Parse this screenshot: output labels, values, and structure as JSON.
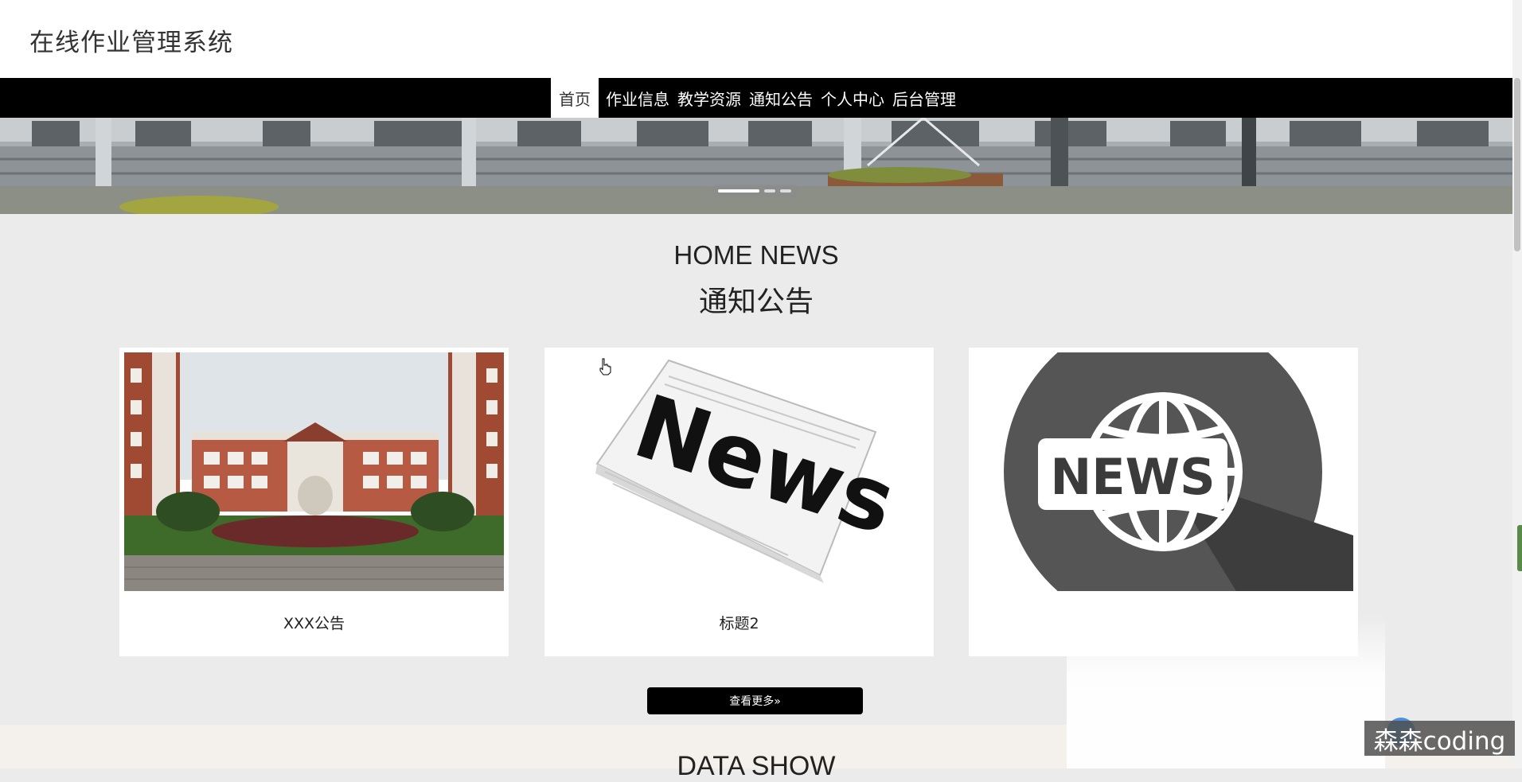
{
  "site": {
    "title": "在线作业管理系统"
  },
  "nav": {
    "items": [
      {
        "label": "首页",
        "active": true
      },
      {
        "label": "作业信息",
        "active": false
      },
      {
        "label": "教学资源",
        "active": false
      },
      {
        "label": "通知公告",
        "active": false
      },
      {
        "label": "个人中心",
        "active": false
      },
      {
        "label": "后台管理",
        "active": false
      }
    ]
  },
  "banner": {
    "slides_total": 3,
    "active_slide": 1
  },
  "news_section": {
    "title_en": "HOME NEWS",
    "title_cn": "通知公告",
    "cards": [
      {
        "caption": "XXX公告",
        "image": "school-building"
      },
      {
        "caption": "标题2",
        "image": "newspaper"
      },
      {
        "caption": "",
        "image": "news-globe-icon"
      }
    ],
    "more_label": "查看更多»"
  },
  "data_section": {
    "title": "DATA SHOW"
  },
  "watermark": {
    "text": "森森coding"
  },
  "colors": {
    "nav_bg": "#000000",
    "page_bg": "#ebebeb",
    "card_bg": "#ffffff",
    "button_bg": "#000000"
  }
}
